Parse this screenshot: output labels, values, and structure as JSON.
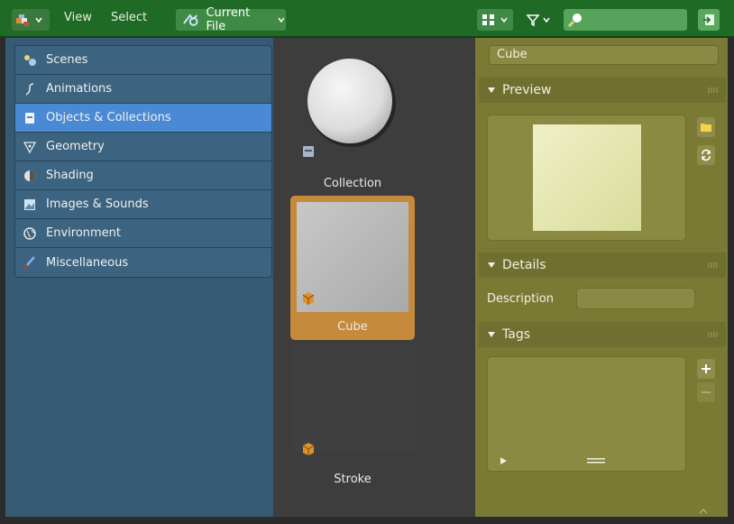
{
  "header": {
    "menu": [
      {
        "label": "View"
      },
      {
        "label": "Select"
      }
    ],
    "library_label": "Current File",
    "search_placeholder": ""
  },
  "sidebar": {
    "items": [
      {
        "label": "Scenes",
        "icon": "scenes-icon",
        "active": false
      },
      {
        "label": "Animations",
        "icon": "animation-icon",
        "active": false
      },
      {
        "label": "Objects & Collections",
        "icon": "collection-icon",
        "active": true
      },
      {
        "label": "Geometry",
        "icon": "geometry-icon",
        "active": false
      },
      {
        "label": "Shading",
        "icon": "shading-icon",
        "active": false
      },
      {
        "label": "Images & Sounds",
        "icon": "image-icon",
        "active": false
      },
      {
        "label": "Environment",
        "icon": "world-icon",
        "active": false
      },
      {
        "label": "Miscellaneous",
        "icon": "brush-icon",
        "active": false
      }
    ]
  },
  "assets": [
    {
      "label": "Collection",
      "type": "collection",
      "selected": false
    },
    {
      "label": "Cube",
      "type": "object",
      "selected": true
    },
    {
      "label": "Stroke",
      "type": "object",
      "selected": false
    }
  ],
  "properties": {
    "name_value": "Cube",
    "panels": {
      "preview": "Preview",
      "details": "Details",
      "tags": "Tags"
    },
    "description_label": "Description",
    "description_value": ""
  },
  "colors": {
    "header_bg": "#1f6a24",
    "sidebar_bg": "#365a73",
    "active_category": "#4a8ad4",
    "selection_orange": "#c58a3c",
    "properties_bg": "#7a7a35"
  }
}
